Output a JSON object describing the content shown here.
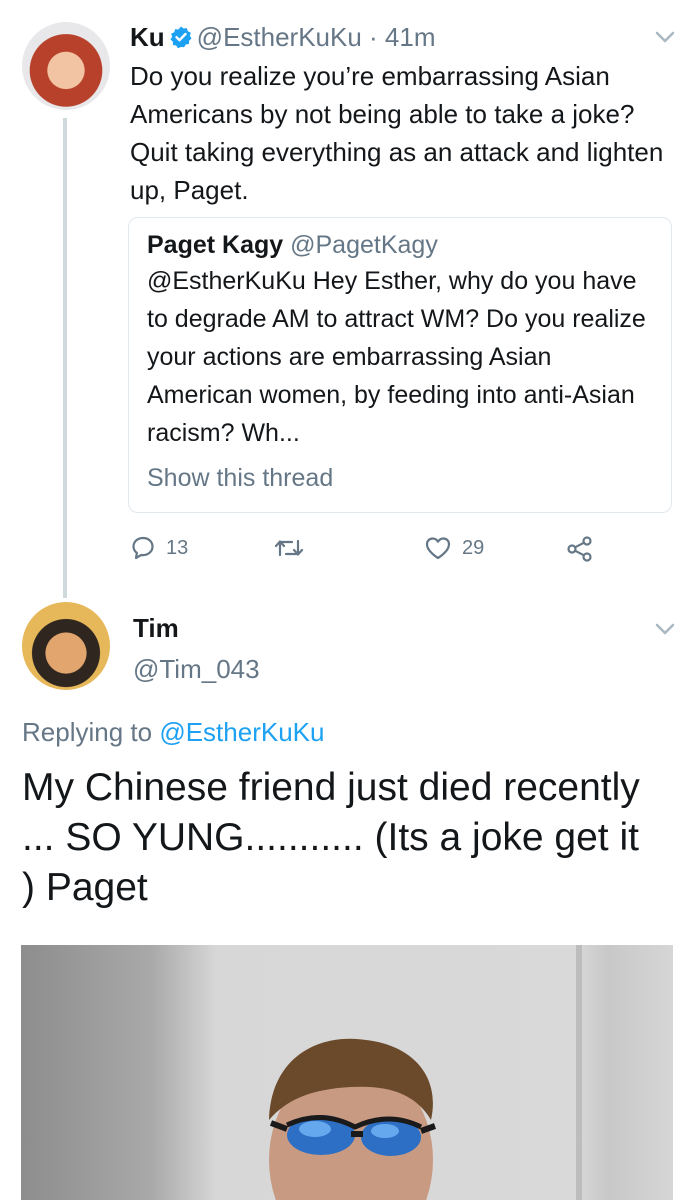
{
  "tweet1": {
    "name": "Ku",
    "handle": "@EstherKuKu",
    "time": "· 41m",
    "text": "Do you realize you’re embarrassing Asian Americans by not being able to take a joke? Quit taking everything as an attack and lighten up, Paget.",
    "quote": {
      "name": "Paget Kagy",
      "handle": "@PagetKagy",
      "text": "@EstherKuKu Hey Esther, why do you have to degrade AM to attract WM? Do you realize your actions are embarrassing Asian American women, by feeding into anti-Asian racism? Wh...",
      "show_thread": "Show this thread"
    },
    "actions": {
      "reply_count": "13",
      "like_count": "29"
    },
    "icons": {
      "reply": "reply-icon",
      "retweet": "retweet-icon",
      "like": "heart-icon",
      "share": "share-icon",
      "verified": "verified-badge-icon",
      "menu": "chevron-down-icon"
    }
  },
  "tweet2": {
    "name": "Tim",
    "handle": "@Tim_043",
    "replying_prefix": "Replying to ",
    "replying_to": "@EstherKuKu",
    "text": "My Chinese friend just died recently ... SO YUNG........... (Its a joke get it ) Paget"
  },
  "colors": {
    "link": "#1da1f2",
    "muted": "#657786",
    "text": "#14171a",
    "border": "#e1e8ed"
  }
}
